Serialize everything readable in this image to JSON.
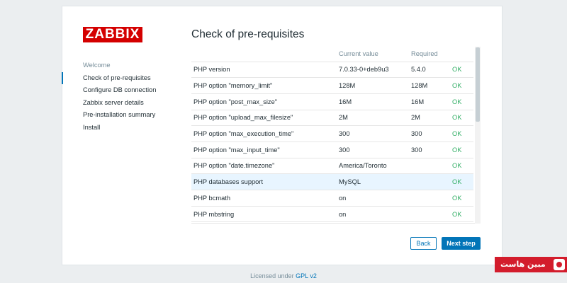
{
  "logo": {
    "text": "ZABBIX",
    "color": "#d40000"
  },
  "steps": [
    {
      "label": "Welcome",
      "state": "done"
    },
    {
      "label": "Check of pre-requisites",
      "state": "current"
    },
    {
      "label": "Configure DB connection",
      "state": "pending"
    },
    {
      "label": "Zabbix server details",
      "state": "pending"
    },
    {
      "label": "Pre-installation summary",
      "state": "pending"
    },
    {
      "label": "Install",
      "state": "pending"
    }
  ],
  "page": {
    "title": "Check of pre-requisites"
  },
  "table": {
    "headers": {
      "name": "",
      "current": "Current value",
      "required": "Required",
      "status": ""
    },
    "rows": [
      {
        "name": "PHP version",
        "current": "7.0.33-0+deb9u3",
        "required": "5.4.0",
        "status": "OK"
      },
      {
        "name": "PHP option \"memory_limit\"",
        "current": "128M",
        "required": "128M",
        "status": "OK"
      },
      {
        "name": "PHP option \"post_max_size\"",
        "current": "16M",
        "required": "16M",
        "status": "OK"
      },
      {
        "name": "PHP option \"upload_max_filesize\"",
        "current": "2M",
        "required": "2M",
        "status": "OK"
      },
      {
        "name": "PHP option \"max_execution_time\"",
        "current": "300",
        "required": "300",
        "status": "OK"
      },
      {
        "name": "PHP option \"max_input_time\"",
        "current": "300",
        "required": "300",
        "status": "OK"
      },
      {
        "name": "PHP option \"date.timezone\"",
        "current": "America/Toronto",
        "required": "",
        "status": "OK"
      },
      {
        "name": "PHP databases support",
        "current": "MySQL",
        "required": "",
        "status": "OK",
        "highlight": true
      },
      {
        "name": "PHP bcmath",
        "current": "on",
        "required": "",
        "status": "OK"
      },
      {
        "name": "PHP mbstring",
        "current": "on",
        "required": "",
        "status": "OK"
      }
    ]
  },
  "buttons": {
    "back": "Back",
    "next": "Next step"
  },
  "footer": {
    "prefix": "Licensed under ",
    "link": "GPL v2"
  },
  "watermark": {
    "text": "مبین هاست"
  },
  "colors": {
    "accent": "#0275b8",
    "ok": "#34af67",
    "highlight_row": "#e8f5ff"
  }
}
